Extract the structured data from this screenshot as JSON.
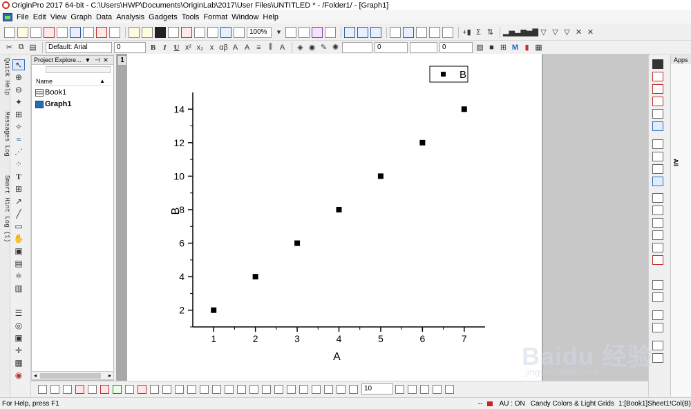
{
  "window": {
    "title": "OriginPro 2017 64-bit - C:\\Users\\HWP\\Documents\\OriginLab\\2017\\User Files\\UNTITLED * - /Folder1/ - [Graph1]"
  },
  "menu": [
    "File",
    "Edit",
    "View",
    "Graph",
    "Data",
    "Analysis",
    "Gadgets",
    "Tools",
    "Format",
    "Window",
    "Help"
  ],
  "toolbar": {
    "zoom": "100%",
    "font_name": "Default: Arial",
    "font_size": "0",
    "line_width": "0",
    "fill_width": "0",
    "bottom_size": "10"
  },
  "left_tabs": [
    "Quick Help",
    "Messages Log",
    "Smart Hint Log (1)"
  ],
  "project_explorer": {
    "title": "Project Explore...",
    "column": "Name",
    "items": [
      {
        "name": "Book1",
        "bold": false
      },
      {
        "name": "Graph1",
        "bold": true
      }
    ]
  },
  "graph_window": {
    "layer_tab": "1"
  },
  "chart_data": {
    "type": "scatter",
    "x": [
      1,
      2,
      3,
      4,
      5,
      6,
      7
    ],
    "series": [
      {
        "name": "B",
        "values": [
          2,
          4,
          6,
          8,
          10,
          12,
          14
        ]
      }
    ],
    "xlabel": "A",
    "ylabel": "B",
    "xlim": [
      0.5,
      7.5
    ],
    "ylim": [
      1,
      15
    ],
    "xticks": [
      1,
      2,
      3,
      4,
      5,
      6,
      7
    ],
    "yticks": [
      2,
      4,
      6,
      8,
      10,
      12,
      14
    ],
    "grid": false,
    "legend": "top-right",
    "marker_color": "#000000"
  },
  "apps_panel": {
    "title": "Apps",
    "tab": "All"
  },
  "statusbar": {
    "help": "For Help, press F1",
    "dots": "--",
    "au": "AU : ON",
    "theme": "Candy Colors & Light Grids",
    "ref": "1:[Book1]Sheet1!Col(B)"
  },
  "watermark": {
    "text": "Baidu 经验",
    "sub": "jingyan.baidu.com"
  }
}
